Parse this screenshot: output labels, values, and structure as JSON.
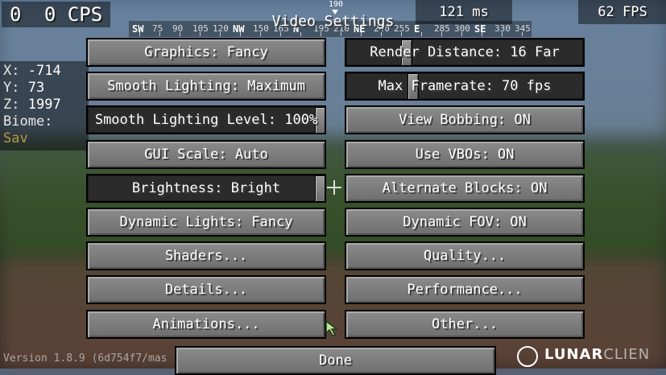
{
  "hud": {
    "cps_left": "0",
    "cps_right": "0 CPS",
    "ping": "121 ms",
    "fps": "62 FPS",
    "bearing": "190"
  },
  "coords": {
    "x_label": "X:",
    "x_value": "-714",
    "y_label": "Y:",
    "y_value": "73",
    "z_label": "Z:",
    "z_value": "1997",
    "biome_label": "Biome:",
    "biome_value": "Sav"
  },
  "compass": {
    "labels": [
      "SW",
      "75",
      "90",
      "105",
      "120",
      "NW",
      "150",
      "165",
      "N",
      "195",
      "210",
      "NE",
      "240",
      "255",
      "E",
      "285",
      "300",
      "SE",
      "330",
      "345"
    ]
  },
  "title": "Video Settings",
  "left_buttons": [
    {
      "label": "Graphics: Fancy",
      "type": "button"
    },
    {
      "label": "Smooth Lighting: Maximum",
      "type": "button"
    },
    {
      "label": "Smooth Lighting Level: 100%",
      "type": "slider",
      "level": 1.0
    },
    {
      "label": "GUI Scale: Auto",
      "type": "button"
    },
    {
      "label": "Brightness: Bright",
      "type": "slider",
      "level": 1.0
    },
    {
      "label": "Dynamic Lights: Fancy",
      "type": "button"
    },
    {
      "label": "Shaders...",
      "type": "button"
    },
    {
      "label": "Details...",
      "type": "button"
    },
    {
      "label": "Animations...",
      "type": "button"
    }
  ],
  "right_buttons": [
    {
      "label": "Render Distance: 16 Far",
      "type": "slider",
      "level": 0.24
    },
    {
      "label": "Max Framerate: 70 fps",
      "type": "slider",
      "level": 0.27
    },
    {
      "label": "View Bobbing: ON",
      "type": "button"
    },
    {
      "label": "Use VBOs: ON",
      "type": "button"
    },
    {
      "label": "Alternate Blocks: ON",
      "type": "button"
    },
    {
      "label": "Dynamic FOV: ON",
      "type": "button"
    },
    {
      "label": "Quality...",
      "type": "button"
    },
    {
      "label": "Performance...",
      "type": "button"
    },
    {
      "label": "Other...",
      "type": "button"
    }
  ],
  "done_label": "Done",
  "footer": {
    "version": "Version 1.8.9 (6d754f7/mas",
    "brand_main": "LUNAR",
    "brand_fade": "CLIEN"
  },
  "icons": {
    "crosshair": "crosshair-icon",
    "cursor": "mouse-cursor-icon",
    "logo": "lunar-logo-icon"
  }
}
